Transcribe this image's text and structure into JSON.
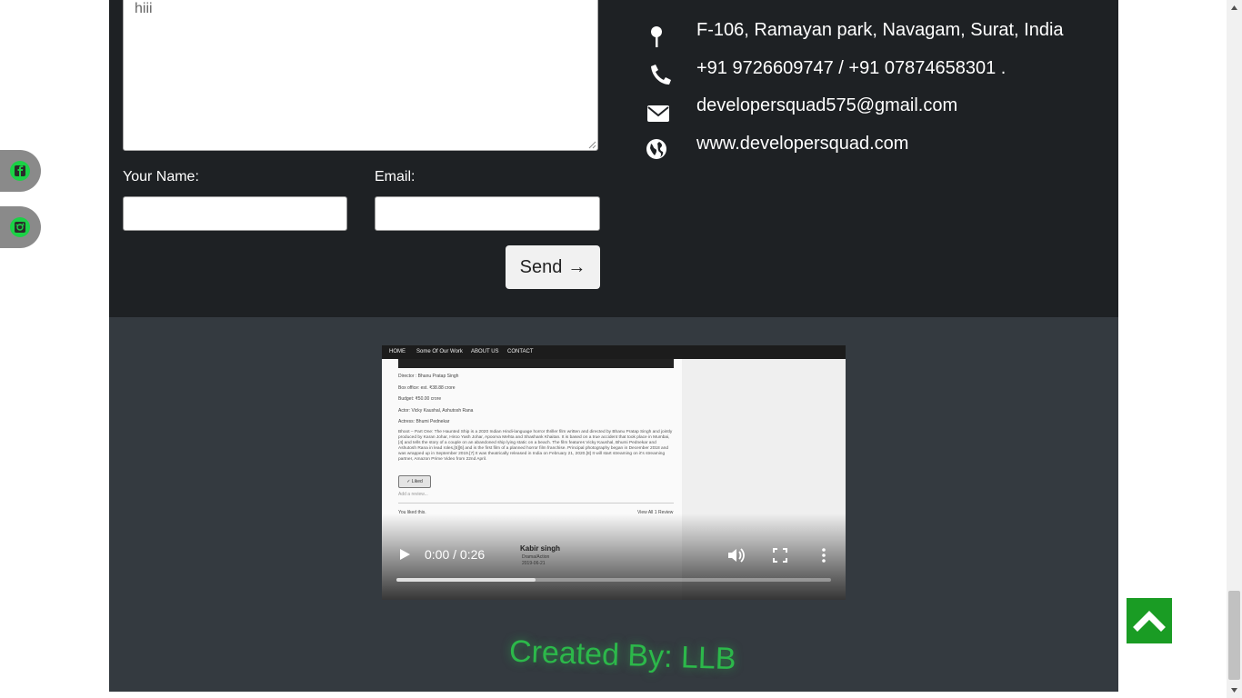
{
  "contact_form": {
    "message_value": "hiii",
    "name_label": "Your Name:",
    "name_value": "",
    "email_label": "Email:",
    "email_value": "",
    "send_label": "Send",
    "send_arrow": "→"
  },
  "contact_info": [
    {
      "icon": "map-pin-icon",
      "text": "F-106, Ramayan park, Navagam, Surat, India"
    },
    {
      "icon": "phone-icon",
      "text": "+91 9726609747 / +91 07874658301 ."
    },
    {
      "icon": "envelope-icon",
      "text": "developersquad575@gmail.com"
    },
    {
      "icon": "globe-icon",
      "text": "www.developersquad.com"
    }
  ],
  "video": {
    "current_time": "0:00",
    "duration": "0:26",
    "time_display": "0:00 / 0:26",
    "buffered_fraction": 0.32,
    "frame": {
      "nav": [
        "HOME",
        "Some Of Our Work",
        "ABOUT US",
        "CONTACT"
      ],
      "lines": [
        "Director : Bhanu Pratap Singh",
        "Box office: est. ₹38.88 crore",
        "Budget: ₹50.00 crore",
        "Actor: Vicky Kaushal, Ashutosh Rana",
        "Actress: Bhumi Pednekar"
      ],
      "paragraph": "Bhoot – Part One: The Haunted Ship is a 2020 Indian Hindi-language horror thriller film written and directed by Bhanu Pratap Singh and jointly produced by Karan Johar, Hiroo Yash Johar, Apoorva Mehta and Shashank Khaitan. It is based on a true accident that took place in Mumbai,[4] and tells the story of a couple on an abandoned ship lying static on a beach. The film features Vicky Kaushal, Bhumi Pednekar and Ashutosh Rana in lead roles,[5][6] and is the first film of a planned horror film franchise. Principal photography began in December 2018 and was wrapped up in September 2019.[7] It was theatrically released in India on February 21, 2020.[8] It will start streaming on it's streaming partner, Amazon Prime Video from 22nd April.",
      "liked": "✓ Liked",
      "review_placeholder": "Add a review...",
      "you_liked": "You liked this.",
      "view_all": "View All 1 Review",
      "card_title": "Kabir singh",
      "card_genre": "Drama/Action",
      "card_date": "2019-06-21"
    }
  },
  "footer": {
    "credit": "Created By: LLB"
  },
  "social": [
    {
      "icon": "facebook-icon"
    },
    {
      "icon": "instagram-icon"
    }
  ],
  "colors": {
    "accent_green": "#1a9c24",
    "credit_green": "#2cb84a",
    "dark_bg": "#1e2124",
    "footer_bg": "#343a40"
  }
}
